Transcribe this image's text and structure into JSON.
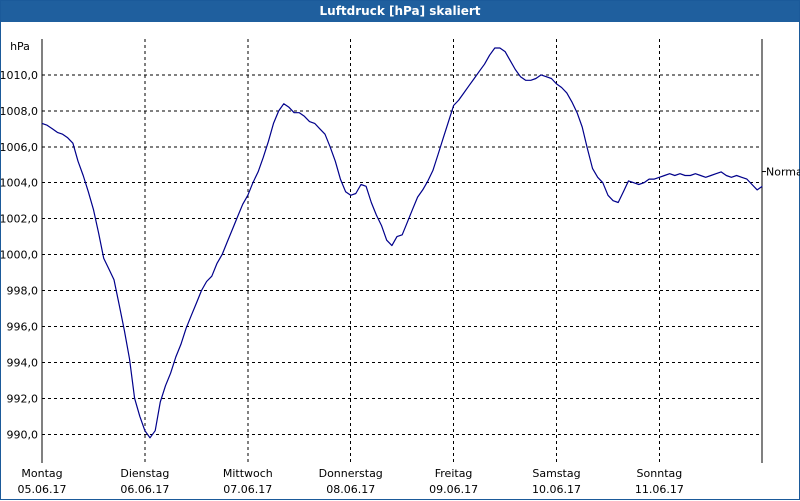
{
  "window": {
    "title": "Luftdruck [hPa] skaliert"
  },
  "chart_data": {
    "type": "line",
    "title": "Luftdruck [hPa] skaliert",
    "ylabel": "hPa",
    "ylim": [
      988.4,
      1012.0
    ],
    "yticks": [
      990,
      992,
      994,
      996,
      998,
      1000,
      1002,
      1004,
      1006,
      1008,
      1010
    ],
    "ytick_labels": [
      "990,0",
      "992,0",
      "994,0",
      "996,0",
      "998,0",
      "1000,0",
      "1002,0",
      "1004,0",
      "1006,0",
      "1008,0",
      "1010,0"
    ],
    "xlim": [
      0,
      7
    ],
    "xticks": [
      {
        "x": 0,
        "day": "Montag",
        "date": "05.06.17"
      },
      {
        "x": 1,
        "day": "Dienstag",
        "date": "06.06.17"
      },
      {
        "x": 2,
        "day": "Mittwoch",
        "date": "07.06.17"
      },
      {
        "x": 3,
        "day": "Donnerstag",
        "date": "08.06.17"
      },
      {
        "x": 4,
        "day": "Freitag",
        "date": "09.06.17"
      },
      {
        "x": 5,
        "day": "Samstag",
        "date": "10.06.17"
      },
      {
        "x": 6,
        "day": "Sonntag",
        "date": "11.06.17"
      }
    ],
    "grid": true,
    "reference": {
      "label": "Normal",
      "value": 1004.4
    },
    "line_color": "#00008b",
    "series": [
      {
        "x": [
          0.0,
          0.05,
          0.1,
          0.15,
          0.2,
          0.25,
          0.3,
          0.35,
          0.4,
          0.45,
          0.5,
          0.55,
          0.6,
          0.65,
          0.7,
          0.75,
          0.8,
          0.85,
          0.9,
          0.95,
          1.0,
          1.05,
          1.1,
          1.15,
          1.2,
          1.25,
          1.3,
          1.35,
          1.4,
          1.45,
          1.5,
          1.55,
          1.6,
          1.65,
          1.7,
          1.75,
          1.8,
          1.85,
          1.9,
          1.95,
          2.0,
          2.05,
          2.1,
          2.15,
          2.2,
          2.25,
          2.3,
          2.35,
          2.4,
          2.45,
          2.5,
          2.55,
          2.6,
          2.65,
          2.7,
          2.75,
          2.8,
          2.85,
          2.9,
          2.95,
          3.0,
          3.05,
          3.1,
          3.15,
          3.2,
          3.25,
          3.3,
          3.35,
          3.4,
          3.45,
          3.5,
          3.55,
          3.6,
          3.65,
          3.7,
          3.75,
          3.8,
          3.85,
          3.9,
          3.95,
          4.0,
          4.05,
          4.1,
          4.15,
          4.2,
          4.25,
          4.3,
          4.35,
          4.4,
          4.45,
          4.5,
          4.55,
          4.6,
          4.65,
          4.7,
          4.75,
          4.8,
          4.85,
          4.9,
          4.95,
          5.0,
          5.05,
          5.1,
          5.15,
          5.2,
          5.25,
          5.3,
          5.35,
          5.4,
          5.45,
          5.5,
          5.55,
          5.6,
          5.65,
          5.7,
          5.75,
          5.8,
          5.85,
          5.9,
          5.95,
          6.0,
          6.05,
          6.1,
          6.15,
          6.2,
          6.25,
          6.3,
          6.35,
          6.4,
          6.45,
          6.5,
          6.55,
          6.6,
          6.65,
          6.7,
          6.75,
          6.8,
          6.85,
          6.9,
          6.95,
          7.0
        ],
        "y": [
          1007.3,
          1007.2,
          1007.0,
          1006.8,
          1006.7,
          1006.5,
          1006.2,
          1005.2,
          1004.4,
          1003.5,
          1002.5,
          1001.2,
          999.8,
          999.2,
          998.6,
          997.2,
          995.8,
          994.2,
          992.0,
          991.0,
          990.2,
          989.8,
          990.2,
          991.8,
          992.7,
          993.4,
          994.3,
          995.0,
          995.9,
          996.6,
          997.3,
          998.0,
          998.5,
          998.8,
          999.5,
          1000.0,
          1000.7,
          1001.4,
          1002.1,
          1002.8,
          1003.3,
          1004.0,
          1004.6,
          1005.4,
          1006.3,
          1007.3,
          1008.0,
          1008.4,
          1008.2,
          1007.9,
          1007.9,
          1007.7,
          1007.4,
          1007.3,
          1007.0,
          1006.7,
          1006.0,
          1005.2,
          1004.2,
          1003.5,
          1003.3,
          1003.4,
          1003.9,
          1003.8,
          1002.9,
          1002.2,
          1001.6,
          1000.8,
          1000.5,
          1001.0,
          1001.1,
          1001.8,
          1002.5,
          1003.2,
          1003.6,
          1004.1,
          1004.7,
          1005.6,
          1006.5,
          1007.4,
          1008.3,
          1008.6,
          1009.0,
          1009.4,
          1009.8,
          1010.2,
          1010.6,
          1011.1,
          1011.5,
          1011.5,
          1011.3,
          1010.8,
          1010.3,
          1009.9,
          1009.7,
          1009.7,
          1009.8,
          1010.0,
          1009.9,
          1009.8,
          1009.5,
          1009.3,
          1009.0,
          1008.5,
          1007.9,
          1007.1,
          1005.9,
          1004.8,
          1004.3,
          1004.0,
          1003.3,
          1003.0,
          1002.9,
          1003.5,
          1004.1,
          1004.0,
          1003.9,
          1004.0,
          1004.2,
          1004.2,
          1004.3,
          1004.4,
          1004.5,
          1004.4,
          1004.5,
          1004.4,
          1004.4,
          1004.5,
          1004.4,
          1004.3,
          1004.4,
          1004.5,
          1004.6,
          1004.4,
          1004.3,
          1004.4,
          1004.3,
          1004.2,
          1003.9,
          1003.6,
          1003.8
        ]
      }
    ]
  }
}
